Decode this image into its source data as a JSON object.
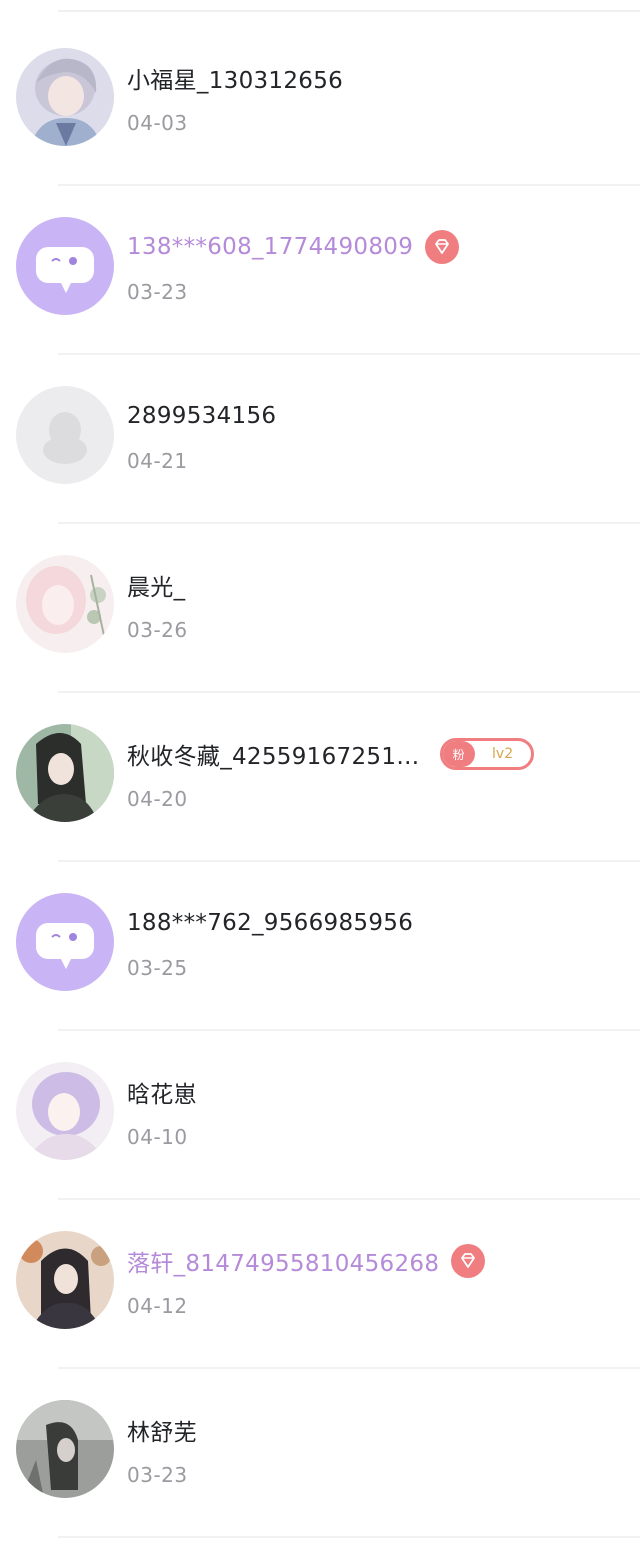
{
  "friends": [
    {
      "name": "小福星_130312656",
      "date": "04-03",
      "vip": false,
      "avatar": "anime-avatar-silver-hair-icon"
    },
    {
      "name": "138***608_1774490809",
      "date": "03-23",
      "vip": true,
      "avatar": "default-chat-bubble-avatar-icon"
    },
    {
      "name": "2899534156",
      "date": "04-21",
      "vip": false,
      "avatar": "default-penguin-avatar-icon"
    },
    {
      "name": "晨光_",
      "date": "03-26",
      "vip": false,
      "avatar": "anime-avatar-pink-floral-icon"
    },
    {
      "name": "秋收冬藏_42559167251…",
      "date": "04-20",
      "vip": false,
      "avatar": "anime-avatar-dark-hair-icon",
      "fan_badge": {
        "label": "粉",
        "level": "lv2"
      }
    },
    {
      "name": "188***762_9566985956",
      "date": "03-25",
      "vip": false,
      "avatar": "default-chat-bubble-avatar-icon"
    },
    {
      "name": "晗花崽",
      "date": "04-10",
      "vip": false,
      "avatar": "anime-avatar-lilac-hair-icon"
    },
    {
      "name": "落轩_81474955810456268",
      "date": "04-12",
      "vip": true,
      "avatar": "anime-avatar-autumn-icon"
    },
    {
      "name": "林舒芜",
      "date": "03-23",
      "vip": false,
      "avatar": "photo-avatar-grayscale-icon"
    }
  ],
  "colors": {
    "vip_name": "#b58ad9",
    "vip_badge": "#f07e80",
    "default_avatar_bg": "#c9b5f5",
    "date_text": "#9a9aa0",
    "name_text": "#222428",
    "level_text": "#d8a64a"
  }
}
